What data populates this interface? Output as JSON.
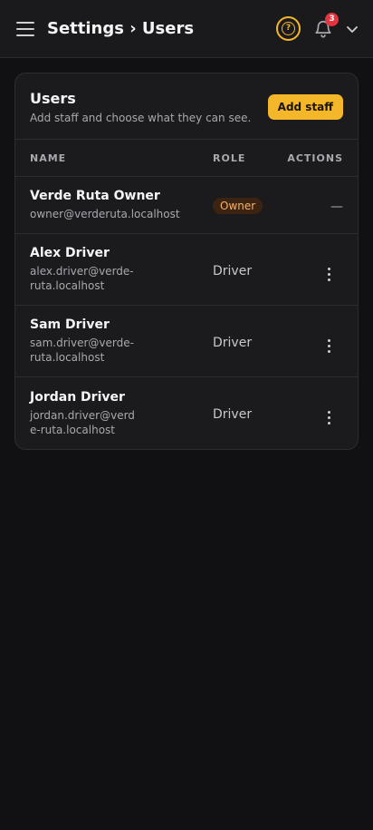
{
  "header": {
    "title": "Settings › Users",
    "help_icon_text": "?",
    "notifications_count": "3",
    "accent": "#f5b72a"
  },
  "card": {
    "title": "Users",
    "subtitle": "Add staff and choose what they can see.",
    "add_button": "Add staff"
  },
  "table": {
    "columns": [
      "NAME",
      "ROLE",
      "ACTIONS"
    ],
    "rows": [
      {
        "name": "Verde Ruta Owner",
        "email": "owner@verderuta.localhost",
        "role": "Owner",
        "action": "—"
      },
      {
        "name": "Alex Driver",
        "email": "alex.driver@verde-ruta.localhost",
        "role": "Driver"
      },
      {
        "name": "Sam Driver",
        "email": "sam.driver@verde-ruta.localhost",
        "role": "Driver"
      },
      {
        "name": "Jordan Driver",
        "email": "jordan.driver@verde-ruta.localhost",
        "role": "Driver"
      }
    ]
  }
}
